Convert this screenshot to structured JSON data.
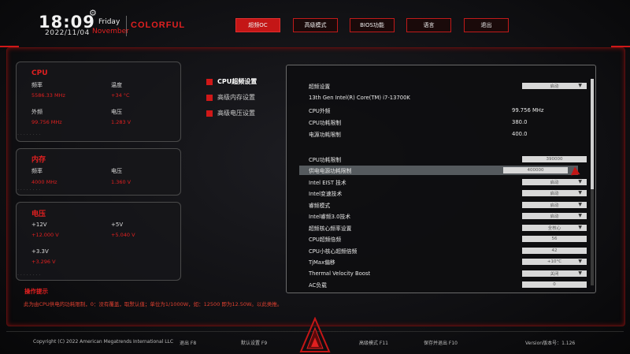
{
  "header": {
    "time": "18:09",
    "date": "2022/11/04",
    "day": "Friday",
    "month": "November",
    "brand": "COLORFUL",
    "tabs": [
      "超频OC",
      "高级模式",
      "BIOS功能",
      "语言",
      "退出"
    ],
    "active_tab": 0
  },
  "cpu_panel": {
    "title": "CPU",
    "freq_label": "频率",
    "freq_value": "5586.33 MHz",
    "temp_label": "温度",
    "temp_value": "+34 °C",
    "bclk_label": "外频",
    "bclk_value": "99.756 MHz",
    "volt_label": "电压",
    "volt_value": "1.283 V"
  },
  "mem_panel": {
    "title": "内存",
    "freq_label": "频率",
    "freq_value": "4000 MHz",
    "volt_label": "电压",
    "volt_value": "1.360 V"
  },
  "volt_panel": {
    "title": "电压",
    "v12_label": "+12V",
    "v12_value": "+12.000 V",
    "v5_label": "+5V",
    "v5_value": "+5.040 V",
    "v33_label": "+3.3V",
    "v33_value": "+3.296 V"
  },
  "menu": {
    "items": [
      "CPU超频设置",
      "高级内存设置",
      "高级电压设置"
    ],
    "active": 0
  },
  "settings": {
    "rows": [
      {
        "label": "超频设置",
        "value": "启动",
        "kind": "select"
      },
      {
        "label": "13th Gen Intel(R) Core(TM) i7-13700K",
        "value": "",
        "kind": "info"
      },
      {
        "label": "CPU外频",
        "value": "99.756 MHz",
        "kind": "text"
      },
      {
        "label": "CPU功耗限制",
        "value": "380.0",
        "kind": "text"
      },
      {
        "label": "电源功耗限制",
        "value": "400.0",
        "kind": "text"
      },
      {
        "label": "CPU功耗限制",
        "value": "390000",
        "kind": "input"
      },
      {
        "label": "供电电源功耗限制",
        "value": "400000",
        "kind": "input",
        "highlight": true
      },
      {
        "label": "Intel EIST 技术",
        "value": "启动",
        "kind": "select"
      },
      {
        "label": "Intel变速技术",
        "value": "启动",
        "kind": "select"
      },
      {
        "label": "睿频模式",
        "value": "启动",
        "kind": "select"
      },
      {
        "label": "Intel睿频3.0技术",
        "value": "启动",
        "kind": "select"
      },
      {
        "label": "超频核心频率设置",
        "value": "全核心",
        "kind": "select"
      },
      {
        "label": "CPU超频倍频",
        "value": "56",
        "kind": "input"
      },
      {
        "label": "CPU小核心超频倍频",
        "value": "42",
        "kind": "input"
      },
      {
        "label": "TjMax偏移",
        "value": "+10°C",
        "kind": "select"
      },
      {
        "label": "Thermal Velocity Boost",
        "value": "关闭",
        "kind": "select"
      },
      {
        "label": "AC负载",
        "value": "0",
        "kind": "input"
      }
    ]
  },
  "help": {
    "title": "操作提示",
    "text": "此为由CPU供电的功耗限制，0：没有覆盖，取默认值；单位为1/1000W，如：12500 即为12.50W。以此类推。"
  },
  "footer": {
    "copyright": "Copyright (C) 2022 American Megatrends International LLC",
    "keys": [
      "退出 F8",
      "默认设置 F9",
      "高级模式 F11",
      "保存并退出 F10"
    ],
    "version": "Version版本号：1.126"
  },
  "colors": {
    "accent": "#d01818",
    "background": "#0c0c0e"
  }
}
